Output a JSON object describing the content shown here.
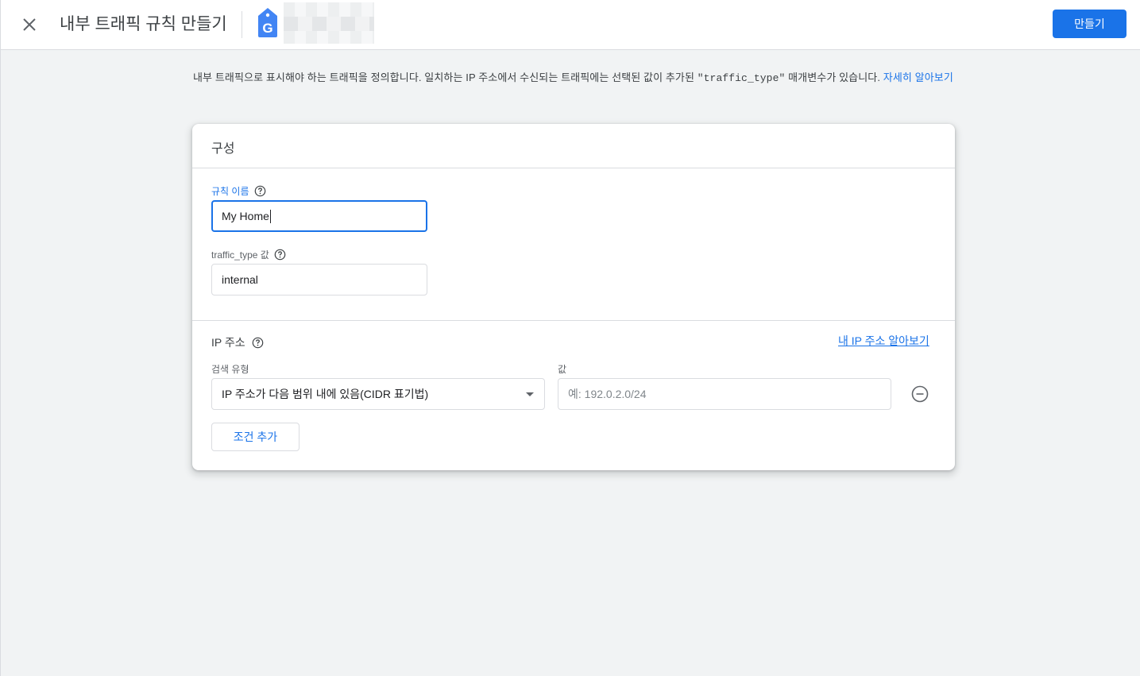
{
  "header": {
    "title": "내부 트래픽 규칙 만들기",
    "create_label": "만들기",
    "logo_letter": "G",
    "logo_color": "#4285f4"
  },
  "intro": {
    "text_before": "내부 트래픽으로 표시해야 하는 트래픽을 정의합니다. 일치하는 IP 주소에서 수신되는 트래픽에는 선택된 값이 추가된 ",
    "param": "\"traffic_type\"",
    "text_after": " 매개변수가 있습니다. ",
    "learn_more": "자세히 알아보기"
  },
  "card": {
    "title": "구성",
    "rule_name": {
      "label": "규칙 이름",
      "value": "My Home"
    },
    "traffic_type": {
      "label": "traffic_type 값",
      "value": "internal"
    },
    "ip_section": {
      "title": "IP 주소",
      "find_my_ip": "내 IP 주소 알아보기",
      "match_type_label": "검색 유형",
      "match_type_value": "IP 주소가 다음 범위 내에 있음(CIDR 표기법)",
      "value_label": "값",
      "value_placeholder": "예: 192.0.2.0/24",
      "add_condition": "조건 추가"
    }
  },
  "colors": {
    "accent": "#1a73e8",
    "border": "#dadce0",
    "background": "#f1f3f4"
  }
}
